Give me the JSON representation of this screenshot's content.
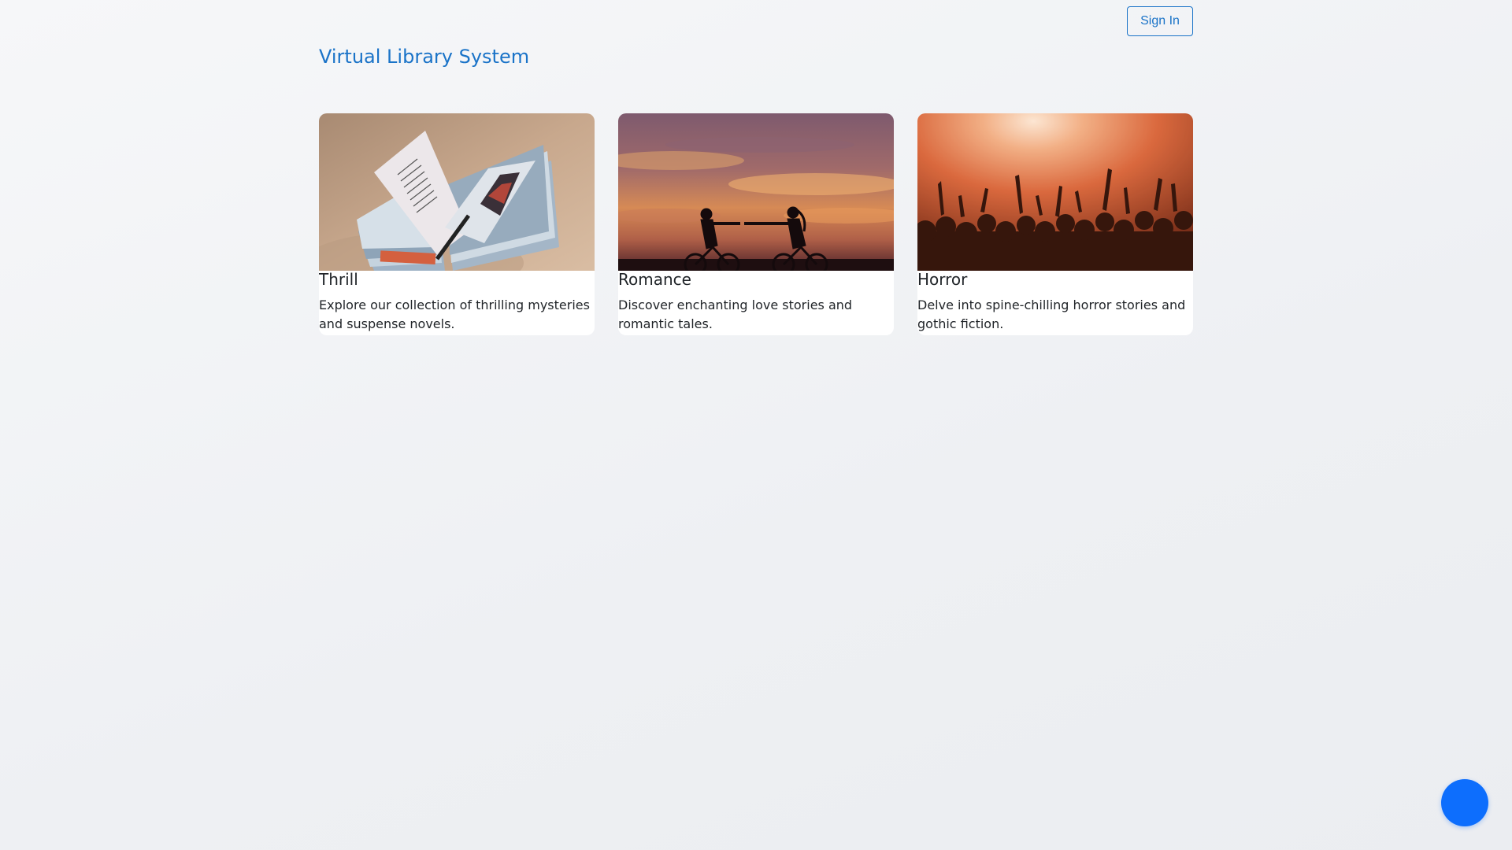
{
  "header": {
    "signin_label": "Sign In",
    "title": "Virtual Library System"
  },
  "cards": [
    {
      "title": "Thrill",
      "text": "Explore our collection of thrilling mysteries and suspense novels.",
      "image_icon": "open-book-image"
    },
    {
      "title": "Romance",
      "text": "Discover enchanting love stories and romantic tales.",
      "image_icon": "sunset-cyclists-image"
    },
    {
      "title": "Horror",
      "text": "Delve into spine-chilling horror stories and gothic fiction.",
      "image_icon": "concert-crowd-image"
    }
  ],
  "fab": {
    "icon": "chat-bubble-icon"
  },
  "colors": {
    "accent": "#1a73c8",
    "fab": "#0d6efd",
    "background": "#f2f3f6"
  }
}
